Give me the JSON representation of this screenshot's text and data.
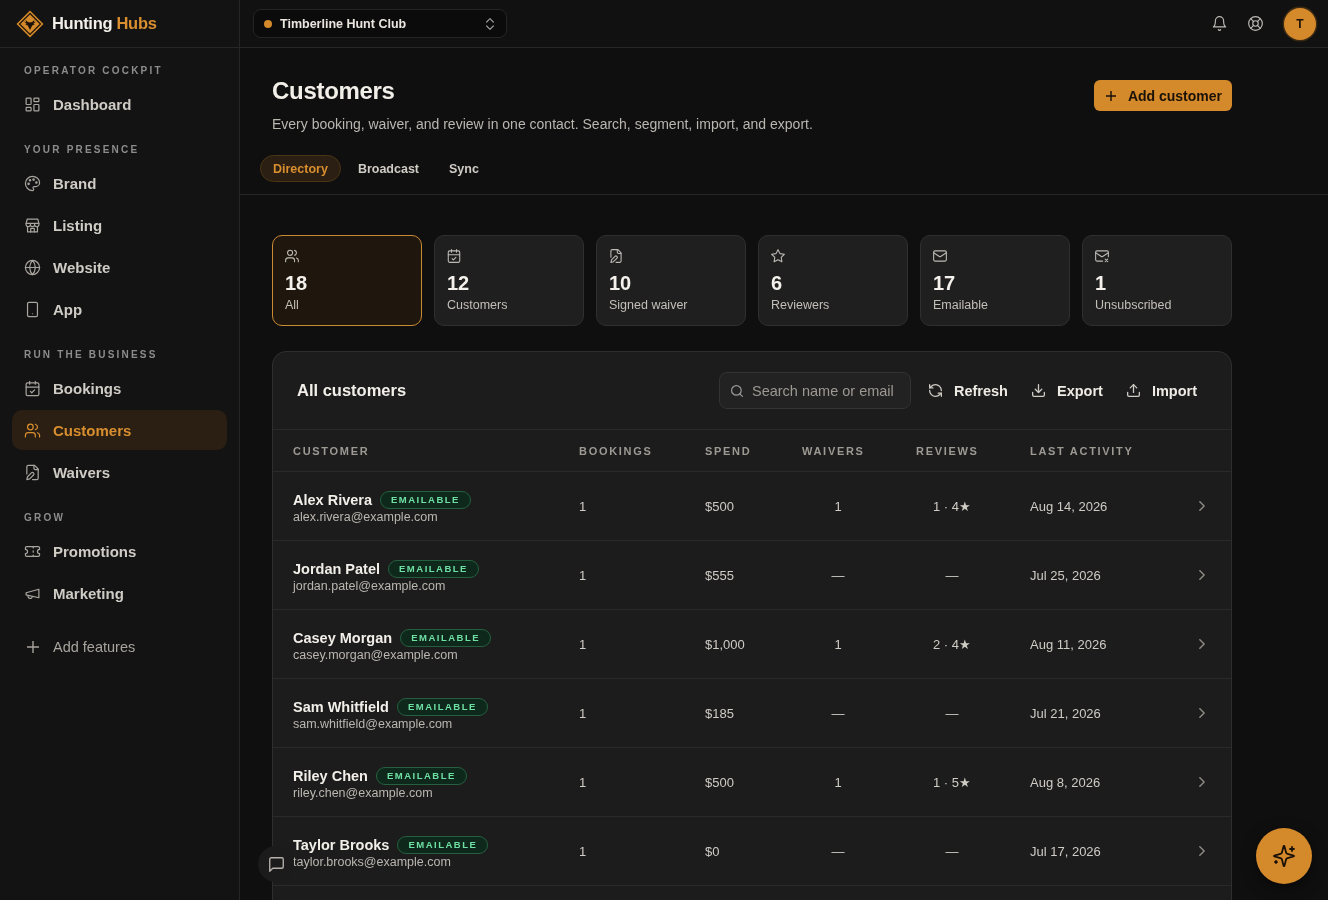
{
  "brand": {
    "name": "Hunting",
    "accent": "Hubs"
  },
  "topbar": {
    "workspace": "Timberline Hunt Club",
    "avatar_initial": "T"
  },
  "sidebar": {
    "sections": [
      {
        "label": "OPERATOR COCKPIT",
        "items": [
          {
            "label": "Dashboard",
            "selected": false
          }
        ]
      },
      {
        "label": "YOUR PRESENCE",
        "items": [
          {
            "label": "Brand",
            "selected": false
          },
          {
            "label": "Listing",
            "selected": false
          },
          {
            "label": "Website",
            "selected": false
          },
          {
            "label": "App",
            "selected": false
          }
        ]
      },
      {
        "label": "RUN THE BUSINESS",
        "items": [
          {
            "label": "Bookings",
            "selected": false
          },
          {
            "label": "Customers",
            "selected": true
          },
          {
            "label": "Waivers",
            "selected": false
          }
        ]
      },
      {
        "label": "GROW",
        "items": [
          {
            "label": "Promotions",
            "selected": false
          },
          {
            "label": "Marketing",
            "selected": false
          }
        ]
      }
    ],
    "add_features": "Add features"
  },
  "page": {
    "title": "Customers",
    "subtitle": "Every booking, waiver, and review in one contact. Search, segment, import, and export.",
    "add_button": "Add customer",
    "tabs": [
      {
        "label": "Directory",
        "selected": true
      },
      {
        "label": "Broadcast",
        "selected": false
      },
      {
        "label": "Sync",
        "selected": false
      }
    ]
  },
  "stats": [
    {
      "value": "18",
      "label": "All",
      "selected": true
    },
    {
      "value": "12",
      "label": "Customers",
      "selected": false
    },
    {
      "value": "10",
      "label": "Signed waiver",
      "selected": false
    },
    {
      "value": "6",
      "label": "Reviewers",
      "selected": false
    },
    {
      "value": "17",
      "label": "Emailable",
      "selected": false
    },
    {
      "value": "1",
      "label": "Unsubscribed",
      "selected": false
    }
  ],
  "table": {
    "title": "All customers",
    "search": {
      "placeholder": "Search name or email"
    },
    "actions": [
      "Refresh",
      "Export",
      "Import"
    ],
    "columns": [
      "CUSTOMER",
      "BOOKINGS",
      "SPEND",
      "WAIVERS",
      "REVIEWS",
      "LAST ACTIVITY"
    ],
    "rows": [
      {
        "name": "Alex Rivera",
        "badge": "EMAILABLE",
        "email": "alex.rivera@example.com",
        "bookings": "1",
        "spend": "$500",
        "waivers": "1",
        "reviews": "1 · 4★",
        "last_activity": "Aug 14, 2026"
      },
      {
        "name": "Jordan Patel",
        "badge": "EMAILABLE",
        "email": "jordan.patel@example.com",
        "bookings": "1",
        "spend": "$555",
        "waivers": "—",
        "reviews": "—",
        "last_activity": "Jul 25, 2026"
      },
      {
        "name": "Casey Morgan",
        "badge": "EMAILABLE",
        "email": "casey.morgan@example.com",
        "bookings": "1",
        "spend": "$1,000",
        "waivers": "1",
        "reviews": "2 · 4★",
        "last_activity": "Aug 11, 2026"
      },
      {
        "name": "Sam Whitfield",
        "badge": "EMAILABLE",
        "email": "sam.whitfield@example.com",
        "bookings": "1",
        "spend": "$185",
        "waivers": "—",
        "reviews": "—",
        "last_activity": "Jul 21, 2026"
      },
      {
        "name": "Riley Chen",
        "badge": "EMAILABLE",
        "email": "riley.chen@example.com",
        "bookings": "1",
        "spend": "$500",
        "waivers": "1",
        "reviews": "1 · 5★",
        "last_activity": "Aug 8, 2026"
      },
      {
        "name": "Taylor Brooks",
        "badge": "EMAILABLE",
        "email": "taylor.brooks@example.com",
        "bookings": "1",
        "spend": "$0",
        "waivers": "—",
        "reviews": "—",
        "last_activity": "Jul 17, 2026"
      }
    ]
  }
}
